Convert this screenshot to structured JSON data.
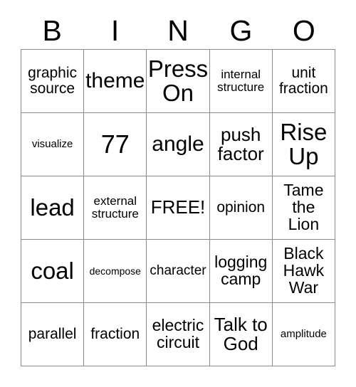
{
  "card": {
    "title": "BINGO",
    "header_letters": [
      "B",
      "I",
      "N",
      "G",
      "O"
    ],
    "grid_size": "5x5",
    "free_space_label": "FREE!",
    "colors": {
      "background": "#ffffff",
      "text": "#000000",
      "grid_line": "#8a8a8a"
    },
    "rows": [
      [
        {
          "text": "graphic\nsource",
          "size": "ml"
        },
        {
          "text": "theme",
          "size": "xxl"
        },
        {
          "text": "Press\nOn",
          "size": "3xl"
        },
        {
          "text": "internal\nstructure",
          "size": "sm"
        },
        {
          "text": "unit\nfraction",
          "size": "ml"
        }
      ],
      [
        {
          "text": "visualize",
          "size": "s"
        },
        {
          "text": "77",
          "size": "4xl"
        },
        {
          "text": "angle",
          "size": "xxl"
        },
        {
          "text": "push\nfactor",
          "size": "xl"
        },
        {
          "text": "Rise\nUp",
          "size": "3xl"
        }
      ],
      [
        {
          "text": "lead",
          "size": "3xl"
        },
        {
          "text": "external\nstructure",
          "size": "sm"
        },
        {
          "text": "FREE!",
          "size": "xl"
        },
        {
          "text": "opinion",
          "size": "ml"
        },
        {
          "text": "Tame\nthe\nLion",
          "size": "l"
        }
      ],
      [
        {
          "text": "coal",
          "size": "3xl"
        },
        {
          "text": "decompose",
          "size": "xs"
        },
        {
          "text": "character",
          "size": "m"
        },
        {
          "text": "logging\ncamp",
          "size": "l"
        },
        {
          "text": "Black\nHawk\nWar",
          "size": "l"
        }
      ],
      [
        {
          "text": "parallel",
          "size": "ml"
        },
        {
          "text": "fraction",
          "size": "ml"
        },
        {
          "text": "electric\ncircuit",
          "size": "l"
        },
        {
          "text": "Talk to\nGod",
          "size": "xl"
        },
        {
          "text": "amplitude",
          "size": "s"
        }
      ]
    ]
  }
}
